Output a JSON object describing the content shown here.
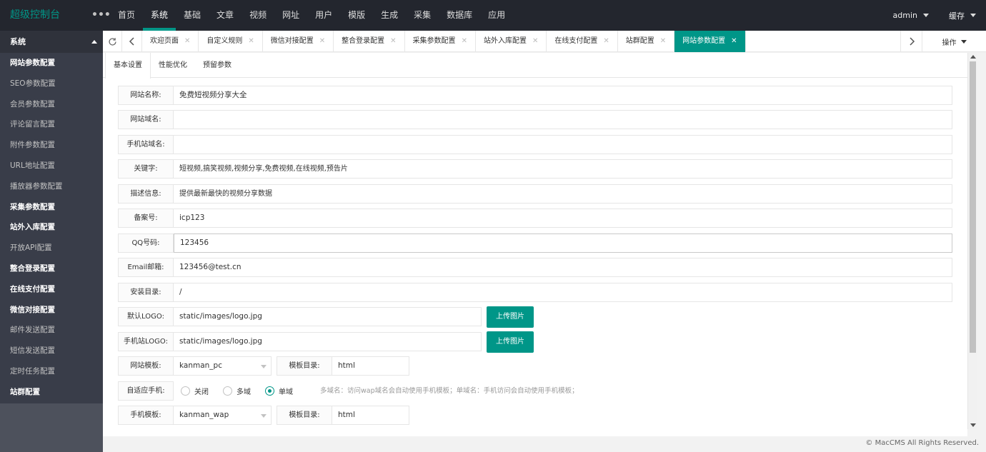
{
  "app": {
    "title": "超级控制台",
    "more": "•••"
  },
  "topnav": [
    "首页",
    "系统",
    "基础",
    "文章",
    "视频",
    "网址",
    "用户",
    "模版",
    "生成",
    "采集",
    "数据库",
    "应用"
  ],
  "topnav_active": 1,
  "user": {
    "name": "admin",
    "cache": "缓存"
  },
  "sidebar": {
    "group": "系统",
    "items": [
      {
        "label": "网站参数配置",
        "bold": true
      },
      {
        "label": "SEO参数配置",
        "bold": false
      },
      {
        "label": "会员参数配置",
        "bold": false
      },
      {
        "label": "评论留言配置",
        "bold": false
      },
      {
        "label": "附件参数配置",
        "bold": false
      },
      {
        "label": "URL地址配置",
        "bold": false
      },
      {
        "label": "播放器参数配置",
        "bold": false
      },
      {
        "label": "采集参数配置",
        "bold": true
      },
      {
        "label": "站外入库配置",
        "bold": true
      },
      {
        "label": "开放API配置",
        "bold": false
      },
      {
        "label": "整合登录配置",
        "bold": true
      },
      {
        "label": "在线支付配置",
        "bold": true
      },
      {
        "label": "微信对接配置",
        "bold": true
      },
      {
        "label": "邮件发送配置",
        "bold": false
      },
      {
        "label": "短信发送配置",
        "bold": false
      },
      {
        "label": "定时任务配置",
        "bold": false
      },
      {
        "label": "站群配置",
        "bold": true
      }
    ]
  },
  "pagetabs": {
    "items": [
      "欢迎页面",
      "自定义规则",
      "微信对接配置",
      "整合登录配置",
      "采集参数配置",
      "站外入库配置",
      "在线支付配置",
      "站群配置",
      "网站参数配置"
    ],
    "active": 8,
    "close_glyph": "✕",
    "ops_label": "操作"
  },
  "subtabs": [
    "基本设置",
    "性能优化",
    "预留参数"
  ],
  "form": {
    "site_name": {
      "label": "网站名称:",
      "value": "免费短视频分享大全"
    },
    "site_domain": {
      "label": "网站域名:",
      "value": ""
    },
    "mobile_domain": {
      "label": "手机站域名:",
      "value": ""
    },
    "keywords": {
      "label": "关键字:",
      "value": "短视频,搞笑视频,视频分享,免费视频,在线视频,预告片"
    },
    "description": {
      "label": "描述信息:",
      "value": "提供最新最快的视频分享数据"
    },
    "icp": {
      "label": "备案号:",
      "value": "icp123"
    },
    "qq": {
      "label": "QQ号码:",
      "value": "123456"
    },
    "email": {
      "label": "Email邮箱:",
      "value": "123456@test.cn"
    },
    "install_dir": {
      "label": "安装目录:",
      "value": "/"
    },
    "logo": {
      "label": "默认LOGO:",
      "value": "static/images/logo.jpg",
      "button": "上传图片"
    },
    "mobile_logo": {
      "label": "手机站LOGO:",
      "value": "static/images/logo.jpg",
      "button": "上传图片"
    },
    "template": {
      "label": "网站模板:",
      "value": "kanman_pc",
      "dir_label": "模板目录:",
      "dir_value": "html"
    },
    "adaptive": {
      "label": "自适应手机:",
      "options": [
        "关闭",
        "多域",
        "单域"
      ],
      "selected": 2,
      "hint": "多域名：访问wap域名会自动使用手机模板；单域名：手机访问会自动使用手机模板；"
    },
    "mobile_template": {
      "label": "手机模板:",
      "value": "kanman_wap",
      "dir_label": "模板目录:",
      "dir_value": "html"
    }
  },
  "footer": "© MacCMS All Rights Reserved.",
  "colors": {
    "accent": "#009688",
    "header_bg": "#23262e",
    "sidebar_bg": "#393d49"
  }
}
